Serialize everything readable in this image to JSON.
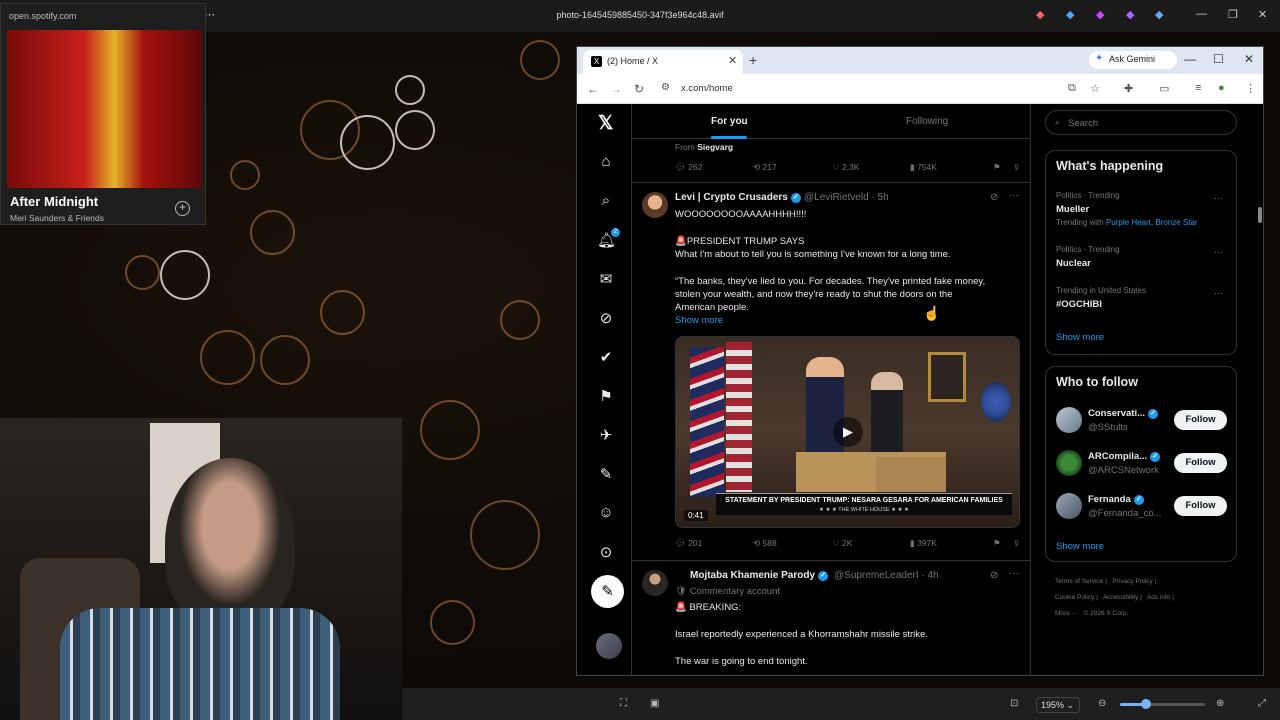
{
  "viewer": {
    "title": "photo-1645459885450-347f3e964c48.avif",
    "zoom": "195%",
    "zoom_fraction": 0.3
  },
  "spotify": {
    "url": "open.spotify.com",
    "song": "After Midnight",
    "artist": "Meri Saunders & Friends",
    "add_icon": "plus-circle-icon"
  },
  "browser": {
    "tab_title": "(2) Home / X",
    "url": "x.com/home",
    "gemini_label": "Ask Gemini"
  },
  "x": {
    "tabs": {
      "for_you": "For you",
      "following": "Following"
    },
    "notif_count": "2",
    "prev_tweet": {
      "from_prefix": "From",
      "from_name": "Siegvarg",
      "replies": "262",
      "reposts": "217",
      "likes": "2.3K",
      "views": "754K"
    },
    "tweet1": {
      "name": "Levi | Crypto Crusaders",
      "handle": "@LeviRietveld",
      "time": "· 5h",
      "lines": [
        "WOOOOOOOOAAAAHHHH!!!!",
        "🚨PRESIDENT TRUMP SAYS",
        "What I'm about to tell you is something I've known for a long time.",
        "“The banks, they've lied to you. For decades. They've printed fake money,",
        "stolen your wealth, and now they're ready to shut the doors on the",
        "American people."
      ],
      "show_more": "Show more",
      "video_banner": "STATEMENT BY PRESIDENT TRUMP: NESARA GESARA FOR AMERICAN FAMILIES",
      "video_sub": "★ ★ ★ THE WHITE HOUSE ★ ★ ★",
      "video_duration": "0:41",
      "replies": "201",
      "reposts": "588",
      "likes": "2K",
      "views": "397K"
    },
    "tweet2": {
      "name": "Mojtaba Khamenie Parody",
      "handle": "@SupremeLeaderI",
      "time": "· 4h",
      "sub": "🛡 Commentary account",
      "lines": [
        "🚨 BREAKING:",
        "Israel reportedly experienced a Khorramshahr missile strike.",
        "The war is going to end tonight."
      ]
    },
    "search_placeholder": "Search",
    "trending": {
      "title": "What's happening",
      "items": [
        {
          "meta": "Politics · Trending",
          "name": "Mueller",
          "with_prefix": "Trending with",
          "with": "Purple Heart, Bronze Star"
        },
        {
          "meta": "Politics · Trending",
          "name": "Nuclear"
        },
        {
          "meta": "Trending in United States",
          "name": "#OGCHIBI"
        }
      ],
      "show_more": "Show more"
    },
    "who_to_follow": {
      "title": "Who to follow",
      "items": [
        {
          "name": "Conservati...",
          "handle": "@SStults",
          "button": "Follow"
        },
        {
          "name": "ARCompila...",
          "handle": "@ARCSNetwork",
          "button": "Follow"
        },
        {
          "name": "Fernanda",
          "handle": "@Fernanda_co...",
          "button": "Follow"
        }
      ],
      "show_more": "Show more"
    },
    "footer": {
      "terms": "Terms of Service",
      "privacy": "Privacy Policy",
      "cookie": "Cookie Policy",
      "accessibility": "Accessibility",
      "ads": "Ads info",
      "more": "More ···",
      "copyright": "© 2026 X Corp."
    }
  },
  "colors": {
    "accent": "#1d9bf0",
    "background": "#000000",
    "text": "#e7e9ea",
    "muted": "#71767b"
  }
}
